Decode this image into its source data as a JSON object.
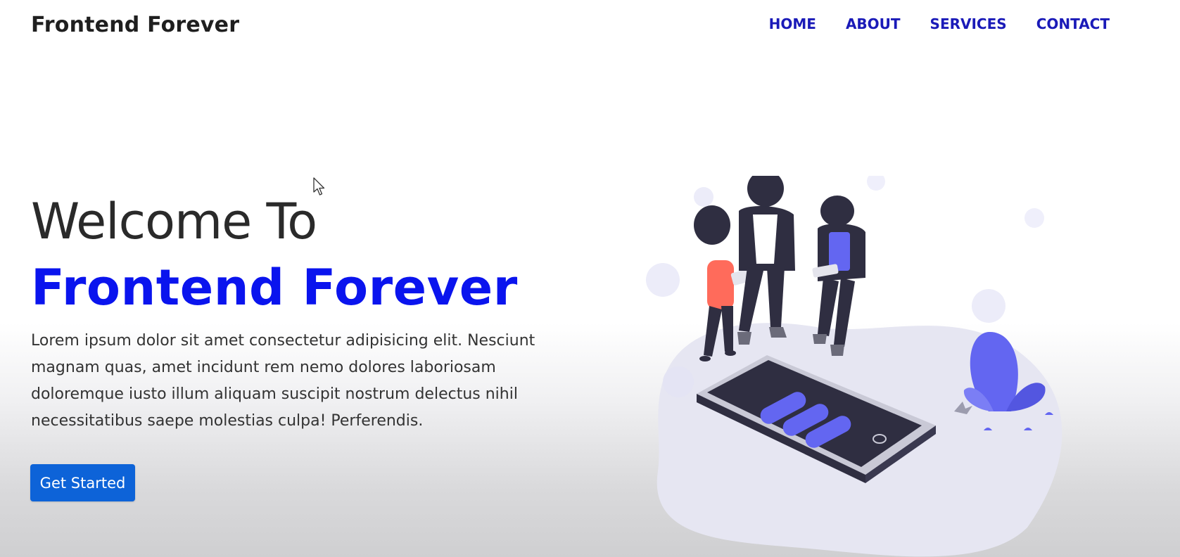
{
  "navbar": {
    "brand": "Frontend Forever",
    "links": [
      "HOME",
      "ABOUT",
      "SERVICES",
      "CONTACT"
    ]
  },
  "hero": {
    "welcome": "Welcome To",
    "title": "Frontend Forever",
    "description": "Lorem ipsum dolor sit amet consectetur adipisicing elit. Nesciunt magnam quas, amet incidunt rem nemo dolores laboriosam doloremque iusto illum aliquam suscipit nostrum delectus nihil necessitatibus saepe molestias culpa! Perferendis.",
    "cta_label": "Get Started"
  },
  "colors": {
    "accent": "#0a14ee",
    "nav_link": "#1a1ab8",
    "button": "#0d63d8",
    "illustration_accent": "#6366f1"
  },
  "icons": {
    "cursor": "mouse-pointer-icon",
    "illustration": "people-with-phone-illustration"
  }
}
